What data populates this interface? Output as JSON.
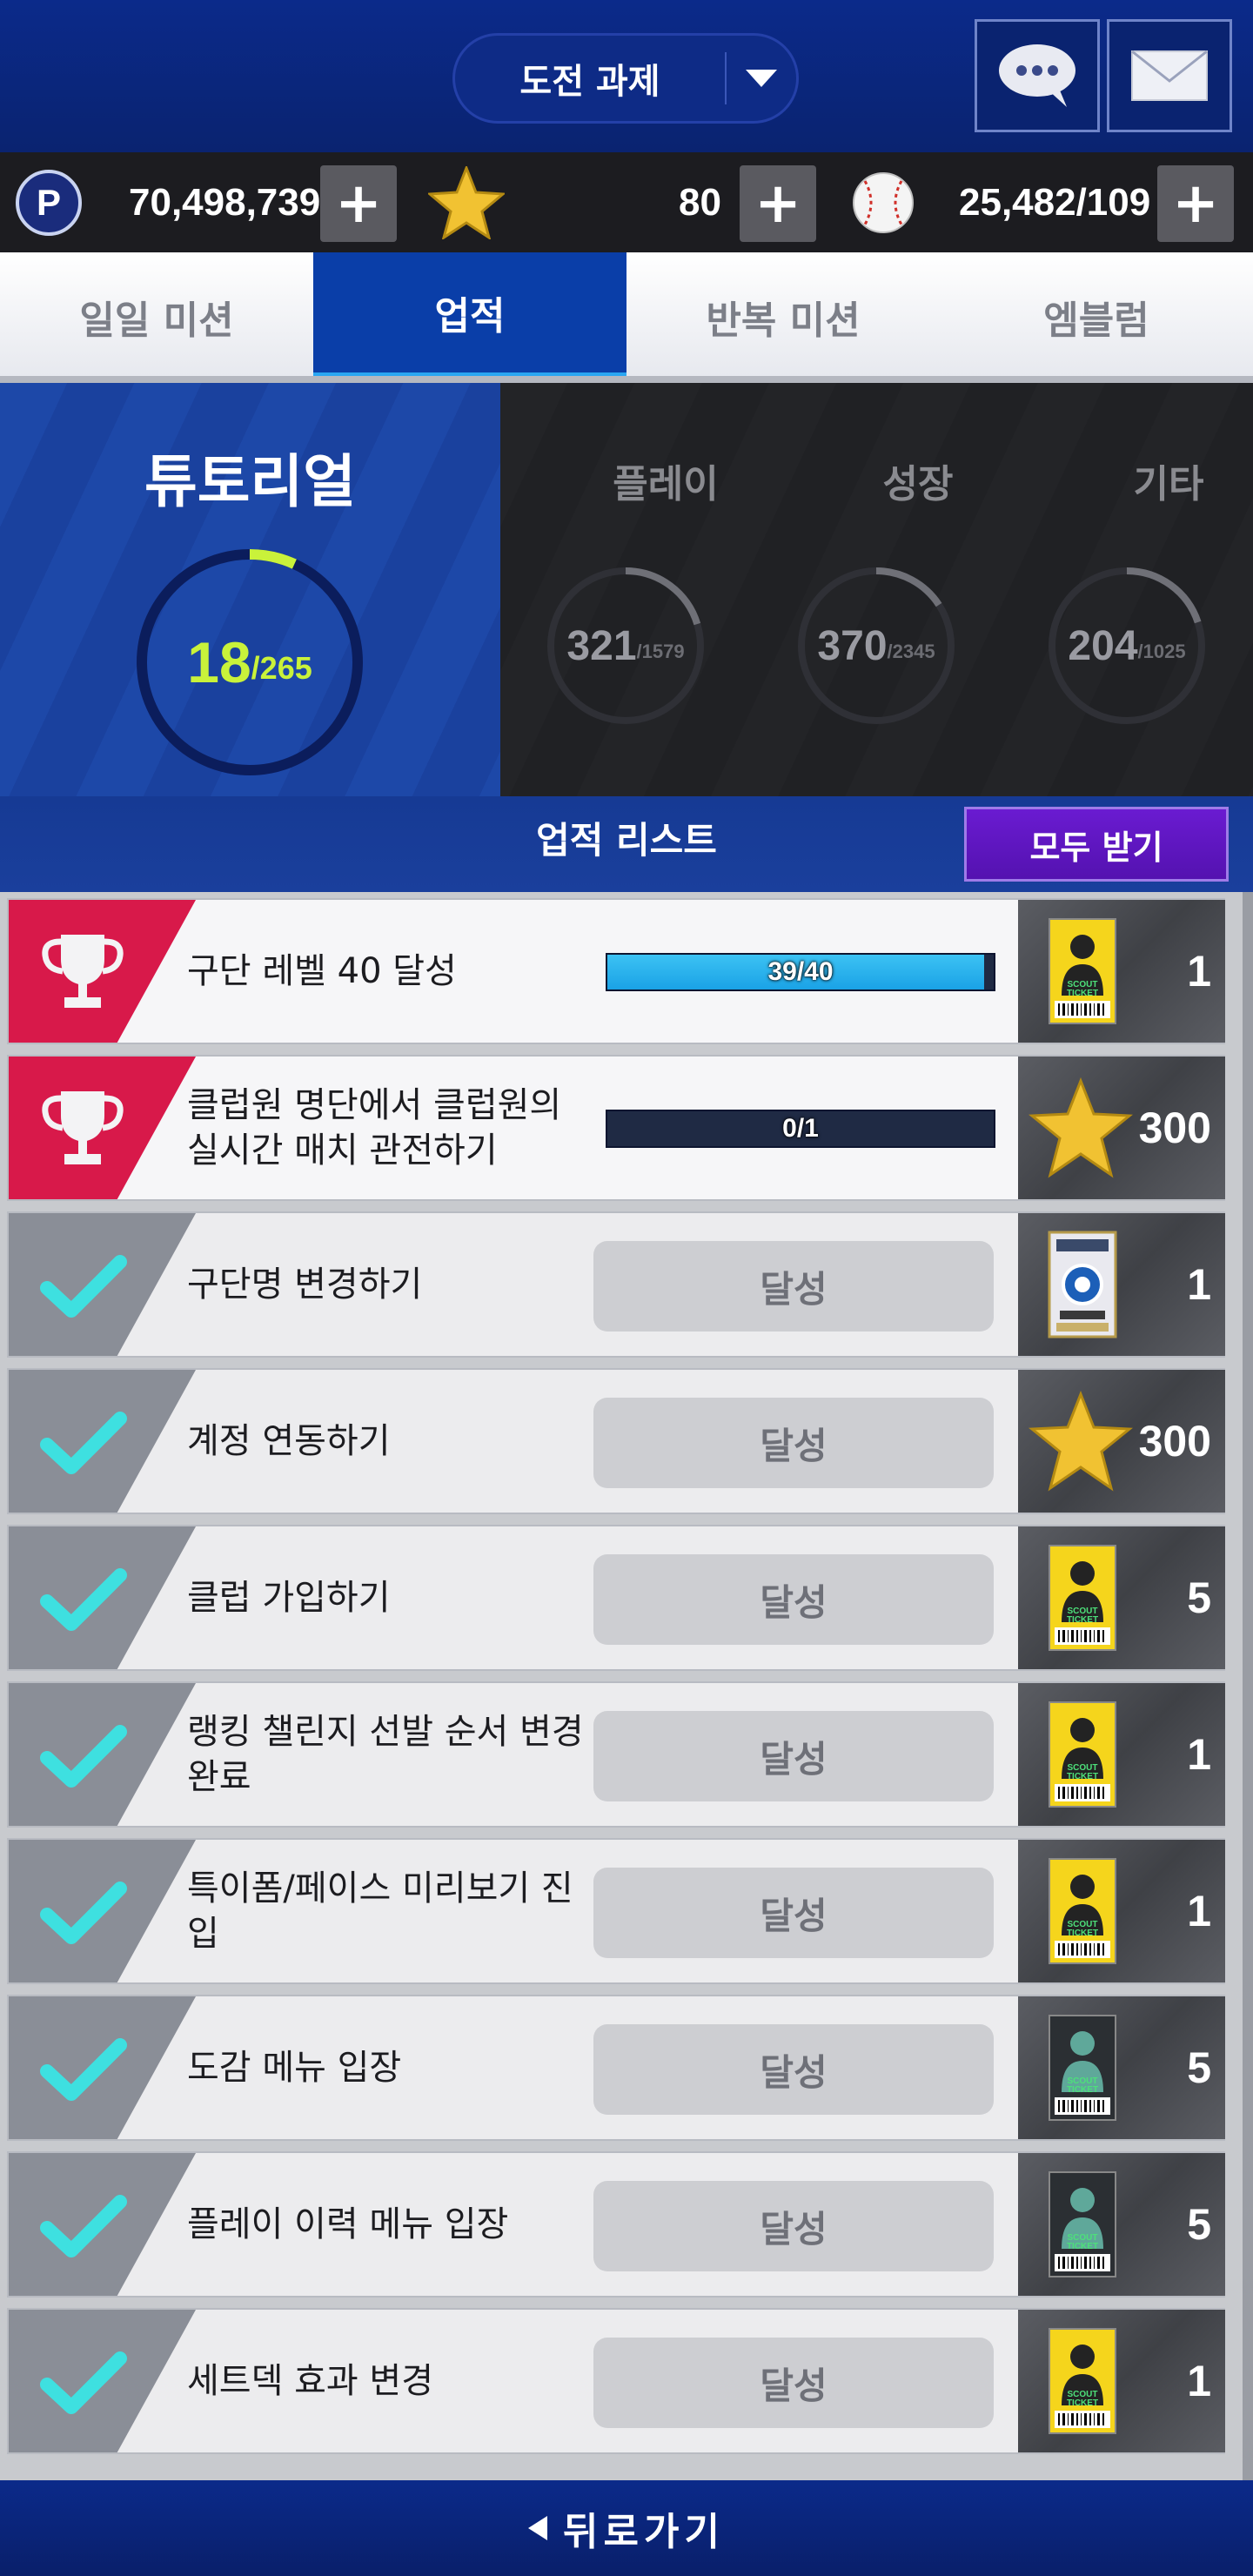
{
  "header": {
    "title": "도전 과제"
  },
  "currency": {
    "points": "70,498,739",
    "stars": "80",
    "balls": "25,482/109"
  },
  "tabs": [
    {
      "label": "일일 미션"
    },
    {
      "label": "업적"
    },
    {
      "label": "반복 미션"
    },
    {
      "label": "엠블럼"
    }
  ],
  "summary": {
    "tutorial": {
      "title": "튜토리얼",
      "current": "18",
      "total": "/265",
      "progress": 0.068
    },
    "categories": [
      {
        "title": "플레이",
        "current": "321",
        "total": "/1579",
        "progress": 0.203
      },
      {
        "title": "성장",
        "current": "370",
        "total": "/2345",
        "progress": 0.158
      },
      {
        "title": "기타",
        "current": "204",
        "total": "/1025",
        "progress": 0.199
      }
    ]
  },
  "list_header": {
    "title": "업적 리스트",
    "claim_all": "모두 받기"
  },
  "achievements": [
    {
      "text": "구단 레벨 40 달성",
      "status": "progress",
      "progress_text": "39/40",
      "progress": 0.975,
      "reward_icon": "scout-ticket-icon",
      "reward_count": "1"
    },
    {
      "text": "클럽원 명단에서 클럽원의 실시간 매치 관전하기",
      "status": "progress",
      "progress_text": "0/1",
      "progress": 0,
      "reward_icon": "star-icon",
      "reward_count": "300"
    },
    {
      "text": "구단명 변경하기",
      "status": "done",
      "done_label": "달성",
      "reward_icon": "player-pack-icon",
      "reward_count": "1"
    },
    {
      "text": "계정 연동하기",
      "status": "done",
      "done_label": "달성",
      "reward_icon": "star-icon",
      "reward_count": "300"
    },
    {
      "text": "클럽 가입하기",
      "status": "done",
      "done_label": "달성",
      "reward_icon": "scout-ticket-icon",
      "reward_count": "5"
    },
    {
      "text": "랭킹 챌린지 선발 순서 변경 완료",
      "status": "done",
      "done_label": "달성",
      "reward_icon": "scout-ticket-icon",
      "reward_count": "1"
    },
    {
      "text": "특이폼/페이스 미리보기 진입",
      "status": "done",
      "done_label": "달성",
      "reward_icon": "scout-ticket-icon",
      "reward_count": "1"
    },
    {
      "text": "도감 메뉴 입장",
      "status": "done",
      "done_label": "달성",
      "reward_icon": "scout-ticket-green-icon",
      "reward_count": "5"
    },
    {
      "text": "플레이 이력 메뉴 입장",
      "status": "done",
      "done_label": "달성",
      "reward_icon": "scout-ticket-green-icon",
      "reward_count": "5"
    },
    {
      "text": "세트덱 효과 변경",
      "status": "done",
      "done_label": "달성",
      "reward_icon": "scout-ticket-icon",
      "reward_count": "1"
    }
  ],
  "footer": {
    "back_label": "뒤로가기"
  },
  "colors": {
    "header_blue": "#0b2a8a",
    "active_tab": "#0a3ea8",
    "tab_underline": "#2aa6f2",
    "ring_tutorial": "#c9f23a",
    "badge_active": "#d8194a",
    "claim_all_purple": "#6a1bd1",
    "check_cyan": "#3ee0e0"
  }
}
